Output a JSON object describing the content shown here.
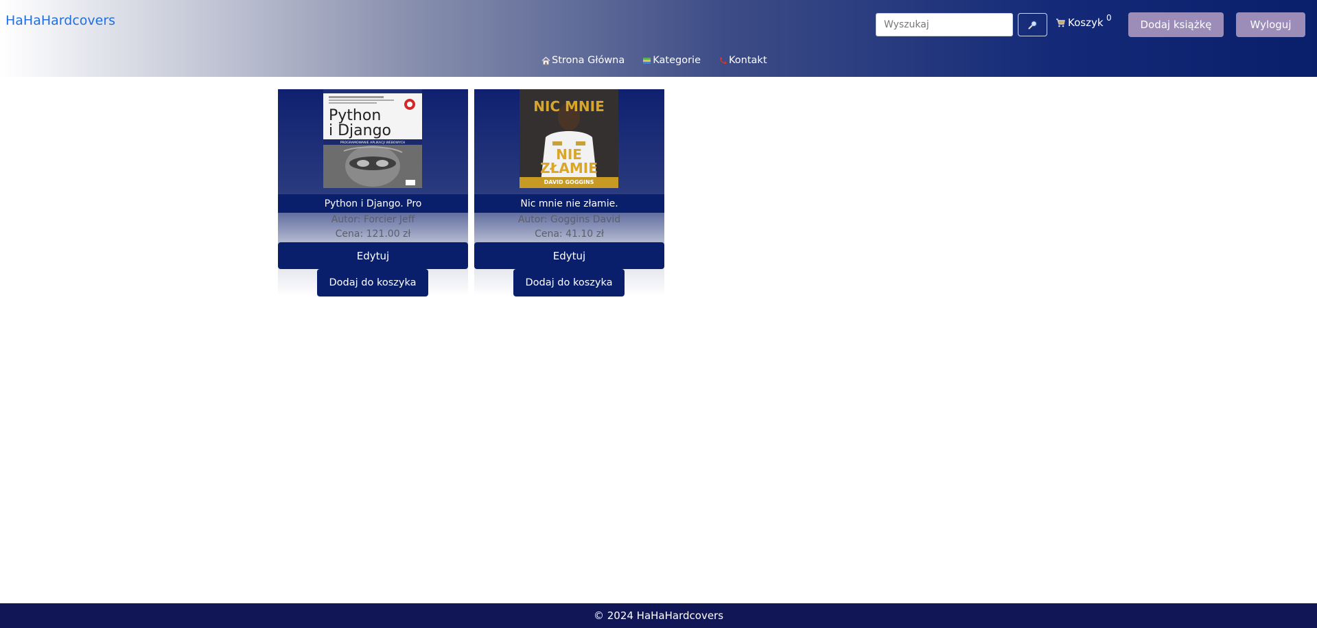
{
  "header": {
    "brand": "HaHaHardcovers",
    "search_placeholder": "Wyszukaj",
    "search_button_icon": "magnifier-icon",
    "cart_label": "Koszyk",
    "cart_count": "0",
    "add_book_label": "Dodaj książkę",
    "logout_label": "Wyloguj"
  },
  "nav": [
    {
      "icon": "home-icon",
      "label": "Strona Główna"
    },
    {
      "icon": "books-icon",
      "label": "Kategorie"
    },
    {
      "icon": "phone-icon",
      "label": "Kontakt"
    }
  ],
  "books": [
    {
      "title": "Python i Django. Pro",
      "author": "Autor: Forcier Jeff",
      "price": "Cena: 121.00 zł",
      "edit_label": "Edytuj",
      "add_to_cart_label": "Dodaj do koszyka",
      "cover_lines": [
        "Python",
        "i Django",
        "PROGRAMOWANIE APLIKACJI WEBOWYCH"
      ]
    },
    {
      "title": "Nic mnie nie złamie.",
      "author": "Autor: Goggins David",
      "price": "Cena: 41.10 zł",
      "edit_label": "Edytuj",
      "add_to_cart_label": "Dodaj do koszyka",
      "cover_lines": [
        "NIC MNIE",
        "NIE",
        "ZŁAMIE",
        "DAVID GOGGINS"
      ]
    }
  ],
  "footer": {
    "text": "© 2024 HaHaHardcovers"
  },
  "colors": {
    "navy": "#0a1f6b",
    "muted_button": "#9b8db8",
    "brand_link": "#1f6fe0",
    "footer": "#111657"
  }
}
